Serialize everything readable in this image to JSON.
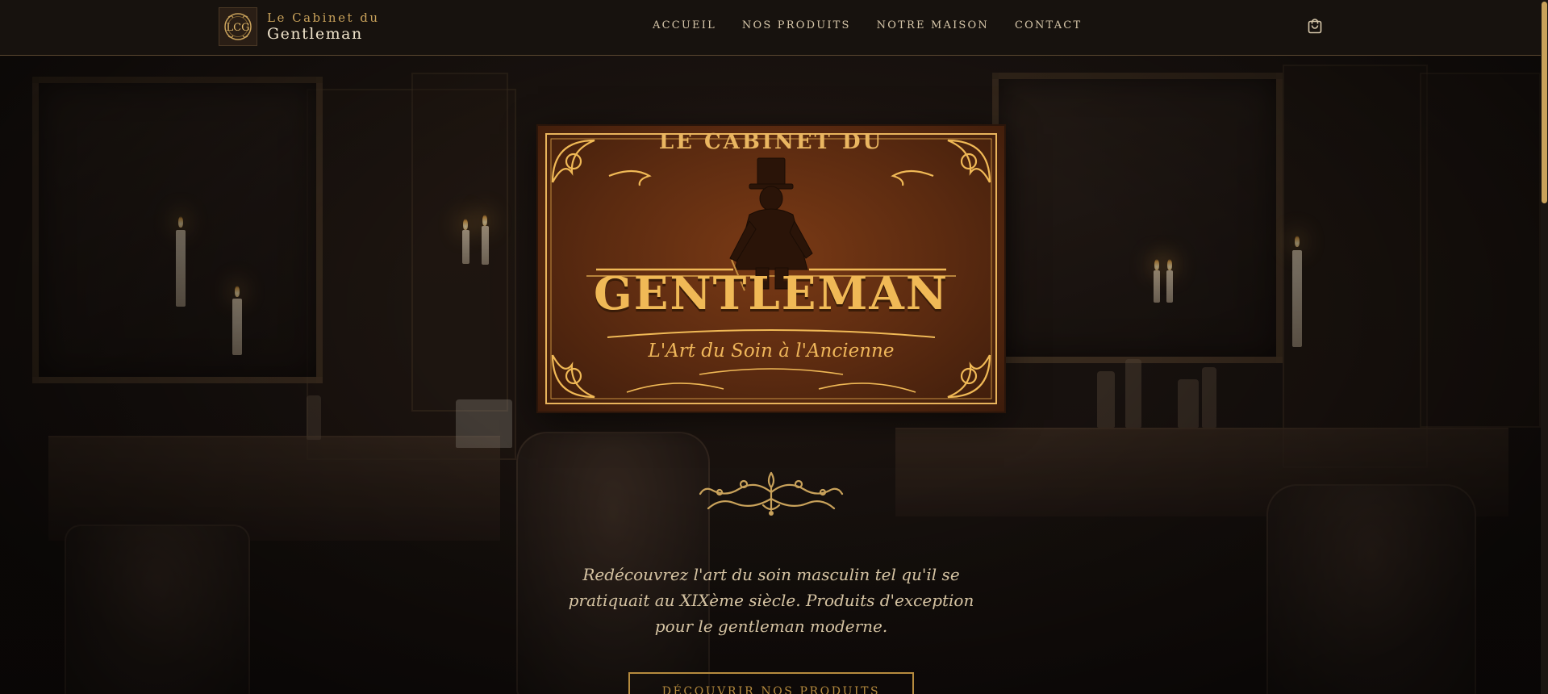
{
  "navbar": {
    "brand": {
      "line1": "Le Cabinet du",
      "line2": "Gentleman",
      "logo_icon": "monogram-lcg-icon",
      "logo_text": "LCG"
    },
    "links": [
      {
        "label": "ACCUEIL"
      },
      {
        "label": "NOS PRODUITS"
      },
      {
        "label": "NOTRE MAISON"
      },
      {
        "label": "CONTACT"
      }
    ],
    "cart_icon": "shopping-bag-icon"
  },
  "hero": {
    "sign": {
      "top": "LE CABINET DU",
      "name": "GENTLEMAN",
      "tagline": "L'Art du Soin à l'Ancienne"
    },
    "ornament_icon": "flourish-ornament-icon",
    "description": "Redécouvrez l'art du soin masculin tel qu'il se pratiquait au XIXème siècle. Produits d'exception pour le gentleman moderne.",
    "cta_label": "DÉCOUVRIR NOS PRODUITS"
  },
  "colors": {
    "gold": "#c9a25b",
    "button_border": "#b68b3e",
    "nav_bg": "#17120e",
    "sign_bg": "#5a2a10"
  }
}
